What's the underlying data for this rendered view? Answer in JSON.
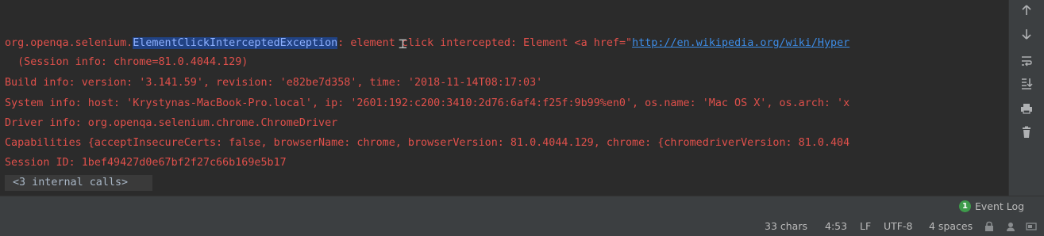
{
  "console": {
    "line1": {
      "prefix": "org.openqa.selenium.",
      "selected": "ElementClickInterceptedException",
      "middle": ": element click intercepted: Element <a href=\"",
      "link": "http://en.wikipedia.org/wiki/Hyper"
    },
    "line2": "  (Session info: chrome=81.0.4044.129)",
    "line3": "Build info: version: '3.141.59', revision: 'e82be7d358', time: '2018-11-14T08:17:03'",
    "line4": "System info: host: 'Krystynas-MacBook-Pro.local', ip: '2601:192:c200:3410:2d76:6af4:f25f:9b99%en0', os.name: 'Mac OS X', os.arch: 'x",
    "line5": "Driver info: org.openqa.selenium.chrome.ChromeDriver",
    "line6": "Capabilities {acceptInsecureCerts: false, browserName: chrome, browserVersion: 81.0.4044.129, chrome: {chromedriverVersion: 81.0.404",
    "line7": "Session ID: 1bef49427d0e67bf2f27c66b169e5b17",
    "internal_calls": "<3 internal calls>"
  },
  "toolbar": {
    "icons": [
      "arrow-up-icon",
      "arrow-down-icon",
      "soft-wrap-icon",
      "scroll-to-end-icon",
      "print-icon",
      "trash-icon"
    ]
  },
  "statusbar": {
    "event_log_count": "1",
    "event_log_label": "Event Log",
    "chars": "33 chars",
    "position": "4:53",
    "line_separator": "LF",
    "encoding": "UTF-8",
    "indent": "4 spaces"
  },
  "colors": {
    "background": "#2b2b2b",
    "error_text": "#e0504b",
    "link": "#3d8ce6",
    "selection": "#214283",
    "event_badge": "#3e9b4b"
  }
}
